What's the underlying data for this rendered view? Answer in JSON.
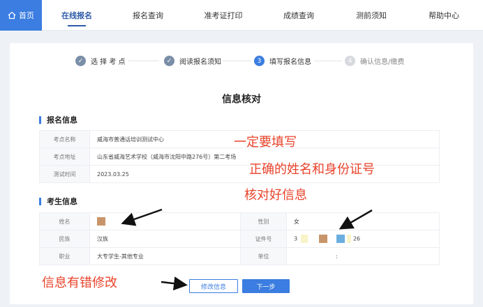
{
  "nav": {
    "home": "首页",
    "items": [
      "在线报名",
      "报名查询",
      "准考证打印",
      "成绩查询",
      "测前须知",
      "帮助中心"
    ]
  },
  "steps": [
    "选 择 考 点",
    "阅读报名须知",
    "填写报名信息",
    "确认信息/缴费"
  ],
  "step_numbers": [
    "3",
    "4"
  ],
  "page_title": "信息核对",
  "registration": {
    "section_title": "报名信息",
    "rows": [
      {
        "label": "考点名称",
        "value": "威海市普通话培训测试中心"
      },
      {
        "label": "考点地址",
        "value": "山东省威海艺术学校（威海市沈阳中路276号）第二考场"
      },
      {
        "label": "测试时间",
        "value": "2023.03.25"
      }
    ]
  },
  "examinee": {
    "section_title": "考生信息",
    "name_label": "姓名",
    "gender_label": "性别",
    "gender_value": "女",
    "ethnicity_label": "民族",
    "ethnicity_value": "汉族",
    "id_label": "证件号",
    "id_prefix": "3",
    "id_suffix": "26",
    "job_label": "职业",
    "job_value": "大专学生-其他专业",
    "unit_label": "单位",
    "unit_value": ":"
  },
  "buttons": {
    "modify": "修改信息",
    "next": "下一步"
  },
  "annotations": {
    "line1": "一定要填写",
    "line2": "正确的姓名和身份证号",
    "line3": "核对好信息",
    "line4": "信息有错修改"
  },
  "colors": {
    "accent": "#3b7de0",
    "annotation": "#e8432b",
    "redaction_brown": "#c8956a",
    "redaction_blue": "#6aaee0",
    "redaction_yellow": "#f8f3c8"
  }
}
